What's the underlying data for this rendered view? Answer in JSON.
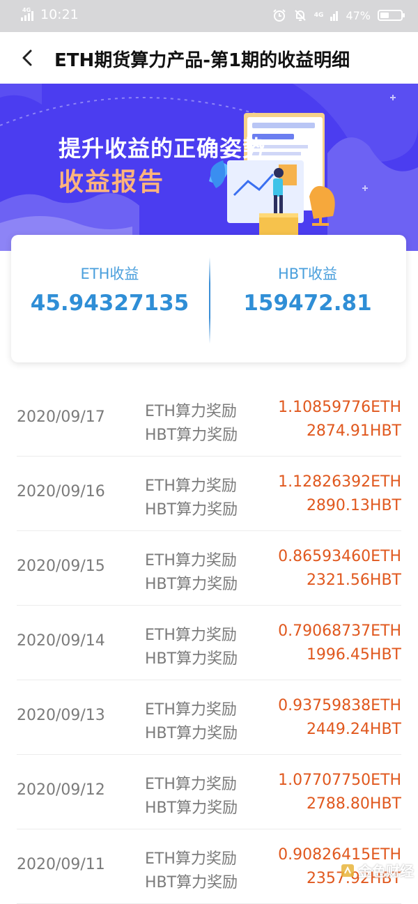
{
  "status_bar": {
    "network_left": "4G",
    "time": "10:21",
    "network_right": "4G",
    "battery_pct": "47%"
  },
  "header": {
    "title": "ETH期货算力产品-第1期的收益明细"
  },
  "banner": {
    "line1": "提升收益的正确姿势",
    "line2": "收益报告"
  },
  "summary": {
    "eth_label": "ETH收益",
    "eth_value": "45.94327135",
    "hbt_label": "HBT收益",
    "hbt_value": "159472.81"
  },
  "records": [
    {
      "date": "2020/09/17",
      "label1": "ETH算力奖励",
      "amount1": "1.10859776ETH",
      "label2": "HBT算力奖励",
      "amount2": "2874.91HBT"
    },
    {
      "date": "2020/09/16",
      "label1": "ETH算力奖励",
      "amount1": "1.12826392ETH",
      "label2": "HBT算力奖励",
      "amount2": "2890.13HBT"
    },
    {
      "date": "2020/09/15",
      "label1": "ETH算力奖励",
      "amount1": "0.86593460ETH",
      "label2": "HBT算力奖励",
      "amount2": "2321.56HBT"
    },
    {
      "date": "2020/09/14",
      "label1": "ETH算力奖励",
      "amount1": "0.79068737ETH",
      "label2": "HBT算力奖励",
      "amount2": "1996.45HBT"
    },
    {
      "date": "2020/09/13",
      "label1": "ETH算力奖励",
      "amount1": "0.93759838ETH",
      "label2": "HBT算力奖励",
      "amount2": "2449.24HBT"
    },
    {
      "date": "2020/09/12",
      "label1": "ETH算力奖励",
      "amount1": "1.07707750ETH",
      "label2": "HBT算力奖励",
      "amount2": "2788.80HBT"
    },
    {
      "date": "2020/09/11",
      "label1": "ETH算力奖励",
      "amount1": "0.90826415ETH",
      "label2": "HBT算力奖励",
      "amount2": "2357.92HBT"
    }
  ],
  "watermark": {
    "text": "金色财经"
  },
  "colors": {
    "banner_bg": "#4b3df0",
    "accent_blue": "#2f8ed6",
    "amount_orange": "#e0581e"
  }
}
